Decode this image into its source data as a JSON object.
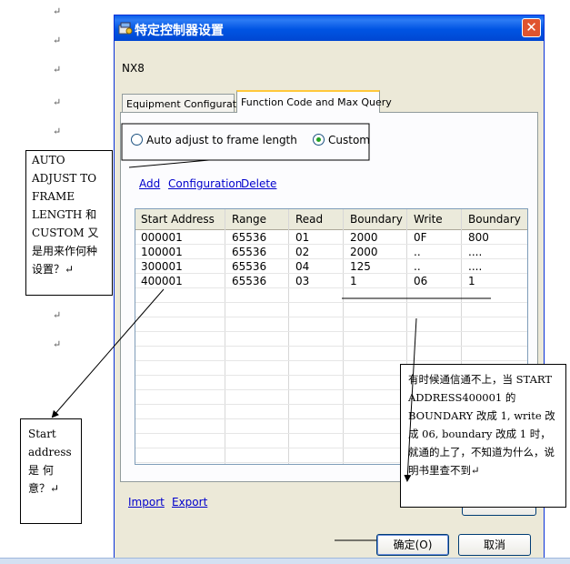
{
  "paragraph_mark": "↵",
  "dialog": {
    "title": "特定控制器设置",
    "close_glyph": "✕",
    "device_name": "NX8",
    "tabs": [
      {
        "label": "Equipment Configuration",
        "active": false
      },
      {
        "label": "Function Code and Max Query",
        "active": true
      }
    ],
    "radio": {
      "auto_label": "Auto adjust to frame length",
      "custom_label": "Custom",
      "selected": "Custom"
    },
    "links": {
      "add": "Add",
      "configuration": "Configuration",
      "delete": "Delete"
    },
    "table": {
      "columns": [
        "Start Address",
        "Range",
        "Read",
        "Boundary",
        "Write",
        "Boundary"
      ],
      "rows": [
        [
          "000001",
          "65536",
          "01",
          "2000",
          "0F",
          "800"
        ],
        [
          "100001",
          "65536",
          "02",
          "2000",
          "..",
          "...."
        ],
        [
          "300001",
          "65536",
          "04",
          "125",
          "..",
          "...."
        ],
        [
          "400001",
          "65536",
          "03",
          "1",
          "06",
          "1"
        ]
      ]
    },
    "bottom_links": {
      "import": "Import",
      "export": "Export"
    },
    "buttons": {
      "ok": "确定(O)",
      "cancel": "取消"
    }
  },
  "annotations": {
    "left_top": "AUTO ADJUST TO FRAME LENGTH 和 CUSTOM 又是用来作何种设置？↵",
    "left_bottom": "Start address 是 何意？↵",
    "right": "有时候通信通不上，当 START ADDRESS400001 的 BOUNDARY 改成 1, write 改成 06, boundary 改成 1 时，就通的上了，不知道为什么，说明书里查不到↵"
  },
  "colors": {
    "titlebar": "#0054E3",
    "dialog_bg": "#ECE9D8",
    "link": "#0000CC",
    "close": "#E0542F"
  }
}
